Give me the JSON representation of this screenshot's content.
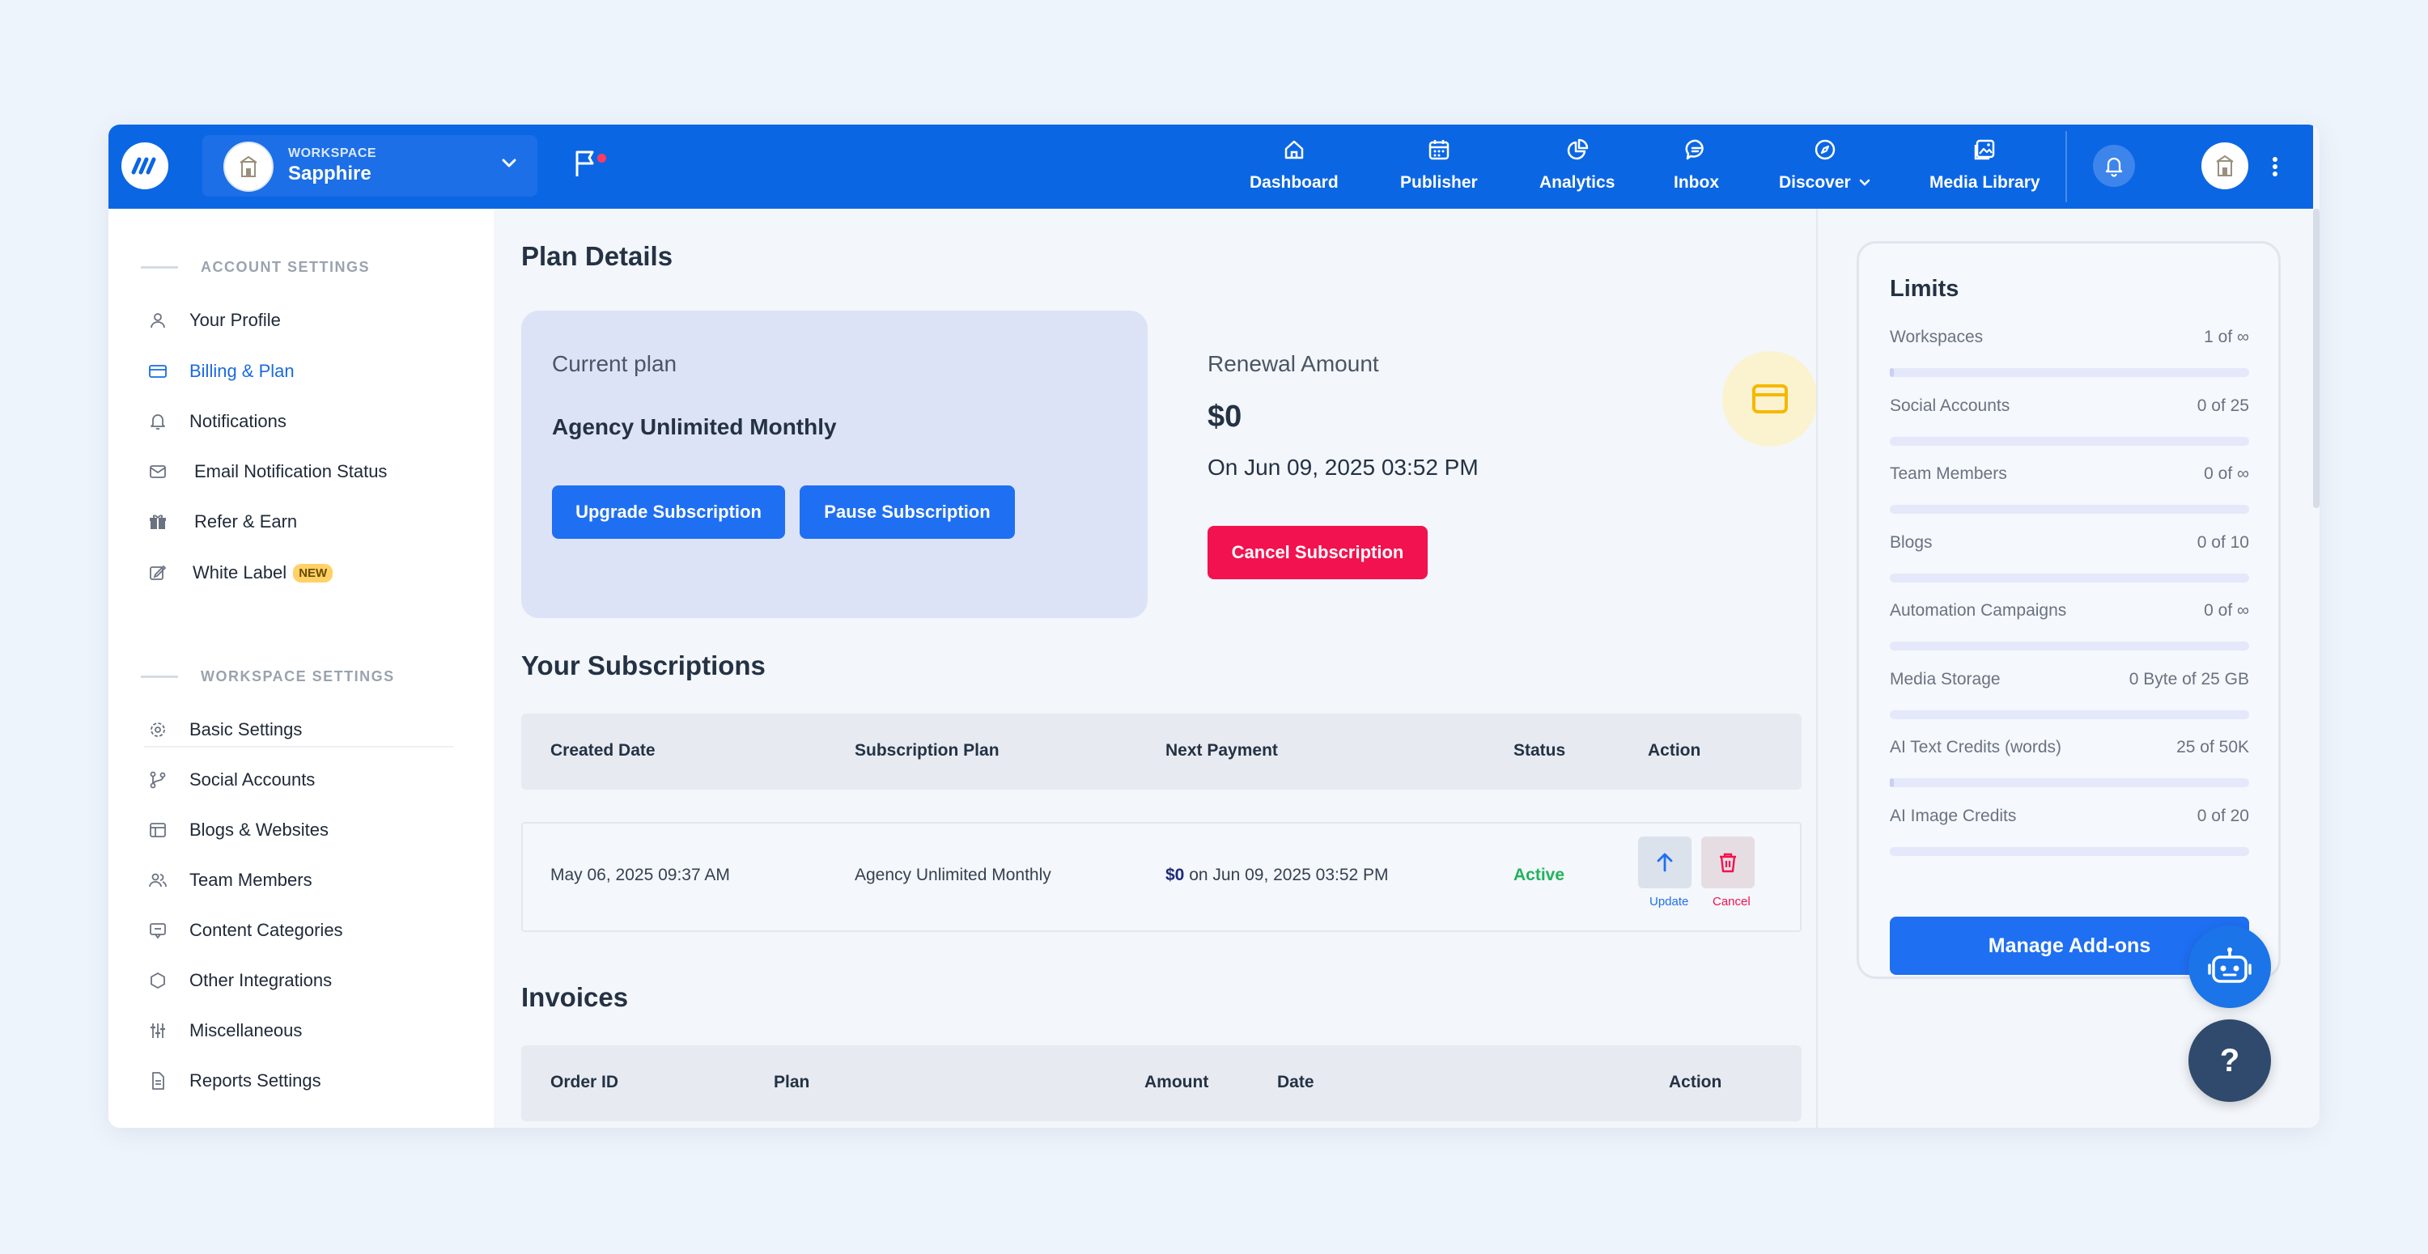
{
  "topbar": {
    "workspace_label": "WORKSPACE",
    "workspace_name": "Sapphire",
    "nav": [
      {
        "label": "Dashboard",
        "icon": "home-icon"
      },
      {
        "label": "Publisher",
        "icon": "calendar-icon"
      },
      {
        "label": "Analytics",
        "icon": "pie-chart-icon"
      },
      {
        "label": "Inbox",
        "icon": "chat-icon"
      },
      {
        "label": "Discover",
        "icon": "compass-icon"
      },
      {
        "label": "Media Library",
        "icon": "image-gallery-icon"
      }
    ]
  },
  "sidebar": {
    "account_heading": "ACCOUNT SETTINGS",
    "account_items": [
      {
        "label": "Your Profile"
      },
      {
        "label": "Billing & Plan"
      },
      {
        "label": "Notifications"
      },
      {
        "label": "Email Notification Status"
      },
      {
        "label": "Refer & Earn"
      },
      {
        "label": "White Label",
        "badge": "NEW"
      }
    ],
    "workspace_heading": "WORKSPACE SETTINGS",
    "workspace_items": [
      {
        "label": "Basic Settings"
      },
      {
        "label": "Social Accounts"
      },
      {
        "label": "Blogs & Websites"
      },
      {
        "label": "Team Members"
      },
      {
        "label": "Content Categories"
      },
      {
        "label": "Other Integrations"
      },
      {
        "label": "Miscellaneous"
      },
      {
        "label": "Reports Settings"
      }
    ]
  },
  "plan": {
    "title": "Plan Details",
    "current_label": "Current plan",
    "current_name": "Agency Unlimited Monthly",
    "upgrade_label": "Upgrade Subscription",
    "pause_label": "Pause Subscription",
    "renewal_label": "Renewal Amount",
    "renewal_amount": "$0",
    "renewal_date": "On Jun 09, 2025 03:52 PM",
    "cancel_label": "Cancel Subscription"
  },
  "subscriptions": {
    "title": "Your Subscriptions",
    "headers": [
      "Created Date",
      "Subscription Plan",
      "Next Payment",
      "Status",
      "Action"
    ],
    "rows": [
      {
        "created": "May 06, 2025 09:37 AM",
        "plan": "Agency Unlimited Monthly",
        "amount": "$0",
        "next": "on Jun 09, 2025 03:52 PM",
        "status": "Active",
        "update_label": "Update",
        "cancel_label": "Cancel"
      }
    ]
  },
  "invoices": {
    "title": "Invoices",
    "headers": [
      "Order ID",
      "Plan",
      "Amount",
      "Date",
      "Action"
    ]
  },
  "limits": {
    "title": "Limits",
    "items": [
      {
        "name": "Workspaces",
        "value": "1 of ∞",
        "fill": 0.01
      },
      {
        "name": "Social Accounts",
        "value": "0 of 25",
        "fill": 0
      },
      {
        "name": "Team Members",
        "value": "0 of ∞",
        "fill": 0
      },
      {
        "name": "Blogs",
        "value": "0 of 10",
        "fill": 0
      },
      {
        "name": "Automation Campaigns",
        "value": "0 of ∞",
        "fill": 0
      },
      {
        "name": "Media Storage",
        "value": "0 Byte of 25 GB",
        "fill": 0
      },
      {
        "name": "AI Text Credits (words)",
        "value": "25 of 50K",
        "fill": 0.0005
      },
      {
        "name": "AI Image Credits",
        "value": "0 of 20",
        "fill": 0
      }
    ],
    "manage_label": "Manage Add-ons"
  },
  "help": {
    "label": "?"
  },
  "colors": {
    "primary": "#0b66e4",
    "button_blue": "#1f6ff2",
    "danger": "#f2124f",
    "success": "#22b35e",
    "active_link": "#1a6be0"
  }
}
